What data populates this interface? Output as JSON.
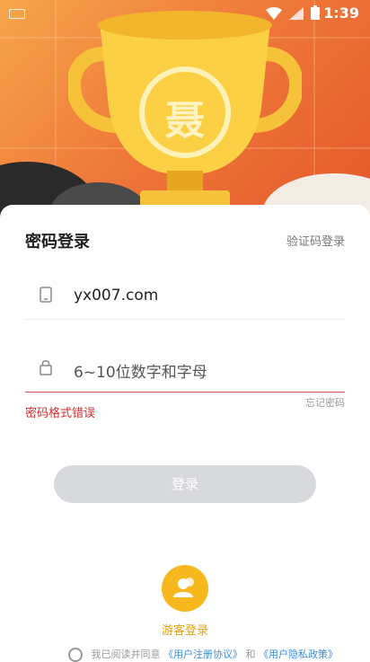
{
  "status": {
    "time": "1:39"
  },
  "trophy": {
    "emblem_char": "聂"
  },
  "login": {
    "title": "密码登录",
    "switch_label": "验证码登录",
    "account_value": "yx007.com",
    "password_placeholder": "6~10位数字和字母",
    "forgot_label": "忘记密码",
    "error_text": "密码格式错误",
    "submit_label": "登录"
  },
  "guest": {
    "label": "游客登录"
  },
  "agreement": {
    "prefix": "我已阅读并同意",
    "user_agreement": "《用户注册协议》",
    "and": "和",
    "privacy": "《用户隐私政策》"
  },
  "colors": {
    "hero": "#ef7a3a",
    "accent": "#f6b81d",
    "error": "#d32f2f",
    "button_disabled": "#d7d9dc"
  }
}
